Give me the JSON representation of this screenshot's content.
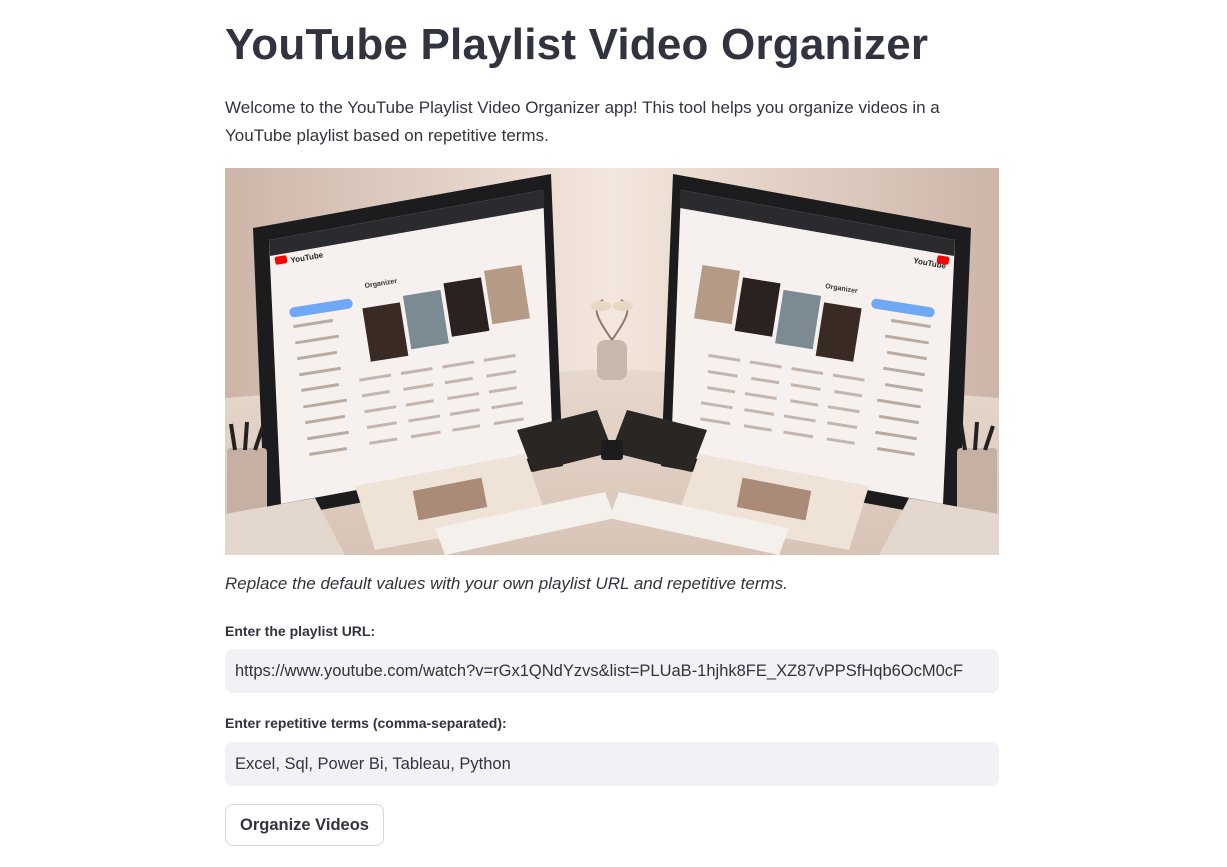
{
  "page": {
    "title": "YouTube Playlist Video Organizer",
    "intro": "Welcome to the YouTube Playlist Video Organizer app! This tool helps you organize videos in a YouTube playlist based on repetitive terms.",
    "caption": "Replace the default values with your own playlist URL and repetitive terms."
  },
  "image": {
    "alt": "Hero illustration",
    "left_screen": {
      "brand": "YouTube",
      "heading": "Organizer"
    },
    "right_screen": {
      "brand": "YouTube",
      "heading": "Organizer"
    }
  },
  "form": {
    "url_label": "Enter the playlist URL:",
    "url_value": "https://www.youtube.com/watch?v=rGx1QNdYzvs&list=PLUaB-1hjhk8FE_XZ87vPPSfHqb6OcM0cF",
    "terms_label": "Enter repetitive terms (comma-separated):",
    "terms_value": "Excel, Sql, Power Bi, Tableau, Python",
    "submit_label": "Organize Videos"
  },
  "colors": {
    "text": "#31333f",
    "input_bg": "#f0f2f6",
    "youtube_red": "#ff0000",
    "sidebar_highlight": "#6fa8f5"
  }
}
